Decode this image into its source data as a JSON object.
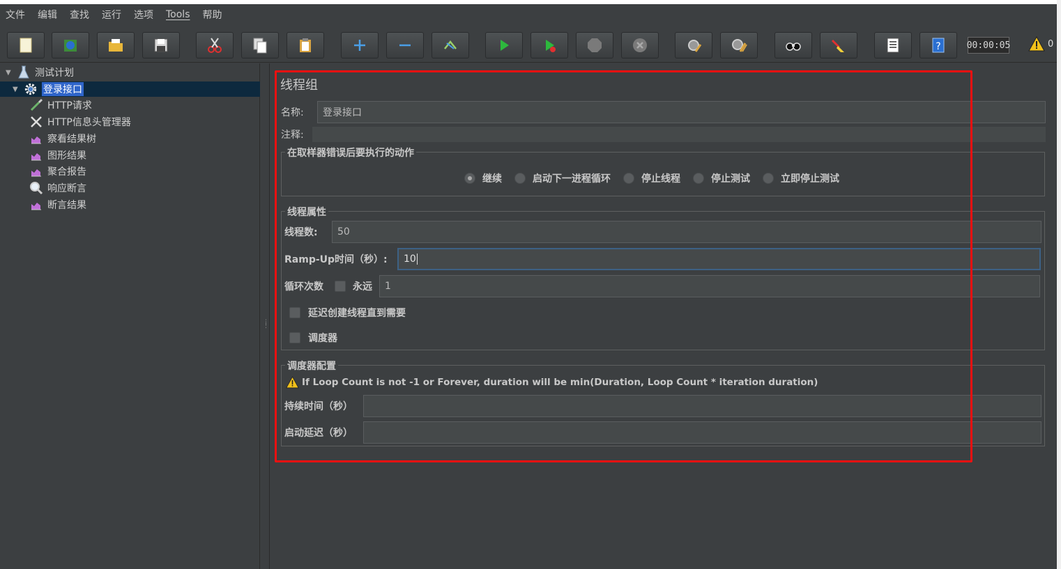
{
  "menu": [
    "文件",
    "编辑",
    "查找",
    "运行",
    "选项",
    "Tools",
    "帮助"
  ],
  "toolbar": {
    "buttons": [
      "new-icon",
      "templates-icon",
      "open-icon",
      "save-icon",
      "cut-icon",
      "copy-icon",
      "paste-icon",
      "expand-icon",
      "collapse-icon",
      "toggle-icon",
      "start-icon",
      "start-no-pause-icon",
      "stop-icon",
      "shutdown-icon",
      "clear-icon",
      "clear-all-icon",
      "search-icon",
      "reset-search-icon",
      "function-helper-icon",
      "help-icon"
    ],
    "timer": "00:00:05",
    "warning_count": "0"
  },
  "tree": {
    "items": [
      {
        "label": "测试计划",
        "icon": "flask-icon"
      },
      {
        "label": "登录接口",
        "icon": "gear-icon"
      },
      {
        "label": "HTTP请求",
        "icon": "pipette-icon"
      },
      {
        "label": "HTTP信息头管理器",
        "icon": "tools-icon"
      },
      {
        "label": "察看结果树",
        "icon": "chart-icon"
      },
      {
        "label": "图形结果",
        "icon": "chart-icon"
      },
      {
        "label": "聚合报告",
        "icon": "chart-icon"
      },
      {
        "label": "响应断言",
        "icon": "magnifier-icon"
      },
      {
        "label": "断言结果",
        "icon": "chart-icon"
      }
    ]
  },
  "panel": {
    "title": "线程组",
    "name_label": "名称:",
    "name_value": "登录接口",
    "comment_label": "注释:",
    "comment_value": "",
    "error_group_title": "在取样器错误后要执行的动作",
    "error_options": [
      {
        "label": "继续",
        "checked": true
      },
      {
        "label": "启动下一进程循环",
        "checked": false
      },
      {
        "label": "停止线程",
        "checked": false
      },
      {
        "label": "停止测试",
        "checked": false
      },
      {
        "label": "立即停止测试",
        "checked": false
      }
    ],
    "thread_group_title": "线程属性",
    "threads_label": "线程数:",
    "threads_value": "50",
    "rampup_label": "Ramp-Up时间（秒）:",
    "rampup_value": "10",
    "loop_label": "循环次数",
    "forever_label": "永远",
    "loop_value": "1",
    "delay_label": "延迟创建线程直到需要",
    "scheduler_label": "调度器",
    "scheduler_group_title": "调度器配置",
    "scheduler_warning": "If Loop Count is not -1 or Forever, duration will be min(Duration, Loop Count * iteration duration)",
    "duration_label": "持续时间（秒）",
    "duration_value": "",
    "startup_delay_label": "启动延迟（秒）",
    "startup_delay_value": ""
  },
  "colors": {
    "highlight_box": "#ee1111",
    "selection": "#2f65ca",
    "background": "#3c3f41"
  }
}
